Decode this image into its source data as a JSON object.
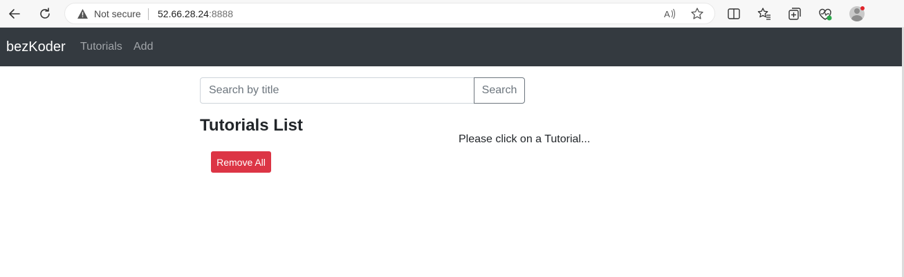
{
  "browser": {
    "security_label": "Not secure",
    "url_host": "52.66.28.24",
    "url_port": ":8888"
  },
  "navbar": {
    "brand": "bezKoder",
    "links": [
      "Tutorials",
      "Add"
    ]
  },
  "search": {
    "placeholder": "Search by title",
    "button_label": "Search"
  },
  "tutorials": {
    "title": "Tutorials List",
    "remove_all_label": "Remove All",
    "hint": "Please click on a Tutorial..."
  },
  "colors": {
    "navbar_bg": "#343a40",
    "danger": "#dc3545",
    "secondary": "#6c757d"
  },
  "icons": [
    "back-icon",
    "refresh-icon",
    "warning-icon",
    "read-aloud-icon",
    "favorite-star-icon",
    "split-screen-icon",
    "favorites-icon",
    "collections-icon",
    "browser-essentials-icon",
    "profile-avatar-icon"
  ]
}
